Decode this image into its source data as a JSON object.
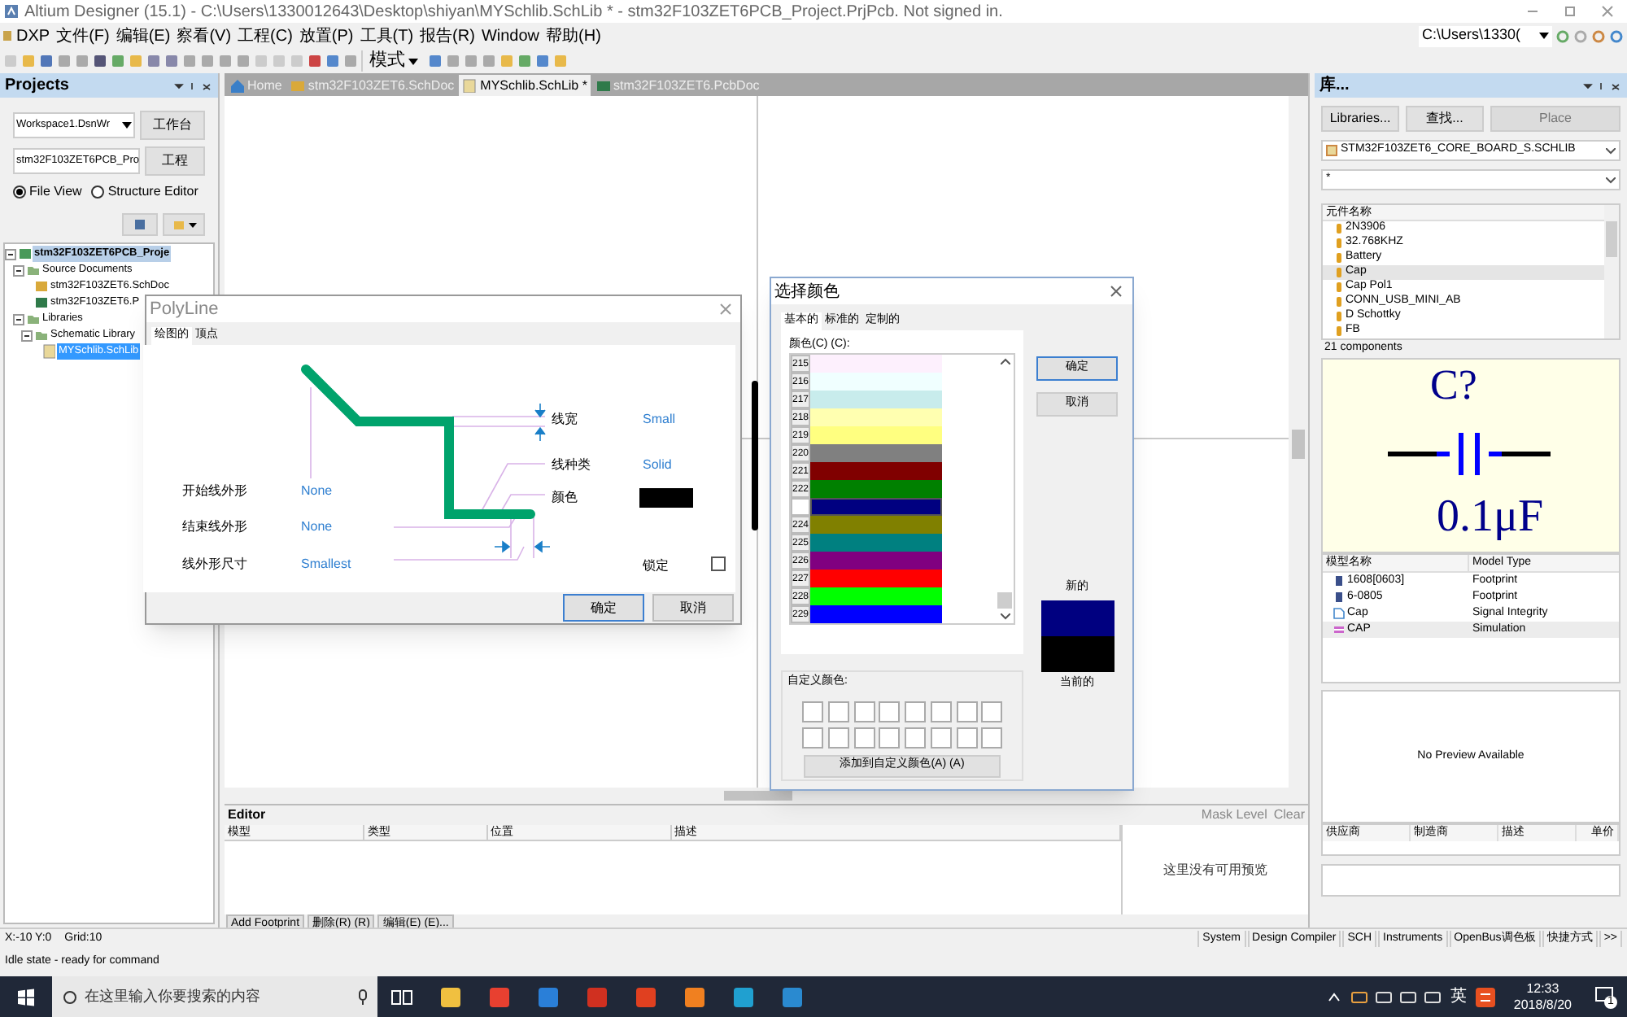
{
  "window": {
    "title": "Altium Designer (15.1) - C:\\Users\\1330012643\\Desktop\\shiyan\\MYSchlib.SchLib * - stm32F103ZET6PCB_Project.PrjPcb. Not signed in."
  },
  "menu": [
    "DXP",
    "文件(F)",
    "编辑(E)",
    "察看(V)",
    "工程(C)",
    "放置(P)",
    "工具(T)",
    "报告(R)",
    "Window",
    "帮助(H)"
  ],
  "toolbar": {
    "mode": "模式",
    "path": "C:\\Users\\1330("
  },
  "projects_panel": {
    "title": "Projects",
    "workspace": "Workspace1.DsnWr",
    "workspace_button": "工作台",
    "project": "stm32F103ZET6PCB_Pro",
    "project_button": "工程",
    "views": [
      {
        "label": "File View",
        "selected": true
      },
      {
        "label": "Structure Editor",
        "selected": false
      }
    ],
    "tree": [
      {
        "label": "stm32F103ZET6PCB_Proje",
        "kind": "project",
        "selected": false,
        "expanded": true,
        "children": [
          {
            "label": "Source Documents",
            "kind": "folder",
            "selected": false,
            "expanded": true,
            "children": [
              {
                "label": "stm32F103ZET6.SchDoc",
                "kind": "schdoc",
                "selected": false
              },
              {
                "label": "stm32F103ZET6.P",
                "kind": "pcbdoc",
                "selected": false
              }
            ]
          },
          {
            "label": "Libraries",
            "kind": "folder",
            "selected": false,
            "expanded": true,
            "children": [
              {
                "label": "Schematic Library",
                "kind": "folder",
                "selected": false,
                "expanded": true,
                "children": [
                  {
                    "label": "MYSchlib.SchLib",
                    "kind": "schlib",
                    "selected": true
                  }
                ]
              }
            ]
          }
        ]
      }
    ]
  },
  "document_tabs": [
    {
      "label": "Home",
      "kind": "home",
      "selected": false
    },
    {
      "label": "stm32F103ZET6.SchDoc",
      "kind": "schdoc",
      "selected": false
    },
    {
      "label": "MYSchlib.SchLib *",
      "kind": "schlib",
      "selected": true
    },
    {
      "label": "stm32F103ZET6.PcbDoc",
      "kind": "pcbdoc",
      "selected": false
    }
  ],
  "editor_panel": {
    "title": "Editor",
    "mask_level": "Mask Level",
    "clear": "Clear",
    "columns": [
      "模型",
      "类型",
      "位置",
      "描述"
    ],
    "empty_message": "这里没有可用预览",
    "buttons": [
      "Add Footprint",
      "删除(R) (R)",
      "编辑(E) (E)..."
    ]
  },
  "polyline_dialog": {
    "title": "PolyLine",
    "tabs": [
      {
        "label": "绘图的",
        "selected": true
      },
      {
        "label": "顶点",
        "selected": false
      }
    ],
    "width_label": "线宽",
    "width": "Small",
    "style_label": "线种类",
    "style": "Solid",
    "color_label": "颜色",
    "color": "#000000",
    "start_shape_label": "开始线外形",
    "start_shape": "None",
    "end_shape_label": "结束线外形",
    "end_shape": "None",
    "shape_size_label": "线外形尺寸",
    "shape_size": "Smallest",
    "locked_label": "锁定",
    "locked": false,
    "ok": "确定",
    "cancel": "取消"
  },
  "color_dialog": {
    "title": "选择颜色",
    "tabs": [
      {
        "label": "基本的",
        "selected": true
      },
      {
        "label": "标准的",
        "selected": false
      },
      {
        "label": "定制的",
        "selected": false
      }
    ],
    "list_label": "颜色(C) (C):",
    "colors": [
      {
        "number": "215",
        "color": "#fdf0fd",
        "selected": false
      },
      {
        "number": "216",
        "color": "#f0ffff",
        "selected": false
      },
      {
        "number": "217",
        "color": "#c8ecec",
        "selected": false
      },
      {
        "number": "218",
        "color": "#ffffb0",
        "selected": false
      },
      {
        "number": "219",
        "color": "#ffff80",
        "selected": false
      },
      {
        "number": "220",
        "color": "#808080",
        "selected": false
      },
      {
        "number": "221",
        "color": "#800000",
        "selected": false
      },
      {
        "number": "222",
        "color": "#008000",
        "selected": false
      },
      {
        "color": "#000080",
        "selected": true
      },
      {
        "number": "224",
        "color": "#808000",
        "selected": false
      },
      {
        "number": "225",
        "color": "#008080",
        "selected": false
      },
      {
        "number": "226",
        "color": "#800080",
        "selected": false
      },
      {
        "number": "227",
        "color": "#ff0000",
        "selected": false
      },
      {
        "number": "228",
        "color": "#00ff00",
        "selected": false
      },
      {
        "number": "229",
        "color": "#0000ff",
        "selected": false
      }
    ],
    "previews": [
      {
        "label": "新的",
        "color": "#000080"
      },
      {
        "label": "当前的",
        "color": "#000000"
      }
    ],
    "custom_label": "自定义颜色:",
    "add_custom": "添加到自定义颜色(A) (A)",
    "ok": "确定",
    "cancel": "取消"
  },
  "library_panel": {
    "title": "库...",
    "buttons": [
      {
        "label": "Libraries...",
        "disabled": false
      },
      {
        "label": "查找...",
        "disabled": false
      },
      {
        "label": "Place",
        "disabled": true
      }
    ],
    "library": "STM32F103ZET6_CORE_BOARD_S.SCHLIB",
    "filter": "*",
    "component_column": "元件名称",
    "components": [
      {
        "name": "2N3906",
        "selected": false
      },
      {
        "name": "32.768KHZ",
        "selected": false
      },
      {
        "name": "Battery",
        "selected": false
      },
      {
        "name": "Cap",
        "selected": true
      },
      {
        "name": "Cap Pol1",
        "selected": false
      },
      {
        "name": "CONN_USB_MINI_AB",
        "selected": false
      },
      {
        "name": "D Schottky",
        "selected": false
      },
      {
        "name": "FB",
        "selected": false
      }
    ],
    "count": "21 components",
    "designator": "C?",
    "value": "0.1μF",
    "model_columns": [
      "模型名称",
      "Model Type"
    ],
    "models": [
      {
        "name": "1608[0603]",
        "type": "Footprint",
        "kind": "footprint",
        "selected": false
      },
      {
        "name": "6-0805",
        "type": "Footprint",
        "kind": "footprint",
        "selected": false
      },
      {
        "name": "Cap",
        "type": "Signal Integrity",
        "kind": "signal",
        "selected": false
      },
      {
        "name": "CAP",
        "type": "Simulation",
        "kind": "simulation",
        "selected": true
      }
    ],
    "no_preview": "No Preview Available",
    "supplier_columns": [
      "供应商",
      "制造商",
      "描述",
      "单价"
    ]
  },
  "status_bar": {
    "coordinates": "X:-10 Y:0",
    "grid": "Grid:10",
    "panels": [
      "System",
      "Design Compiler",
      "SCH",
      "Instruments",
      "OpenBus调色板",
      "快捷方式",
      ">>"
    ],
    "message": "Idle state - ready for command"
  },
  "taskbar": {
    "search_placeholder": "在这里输入你要搜索的内容",
    "ime": "英",
    "time": "12:33",
    "date": "2018/8/20",
    "notifications": "1"
  }
}
